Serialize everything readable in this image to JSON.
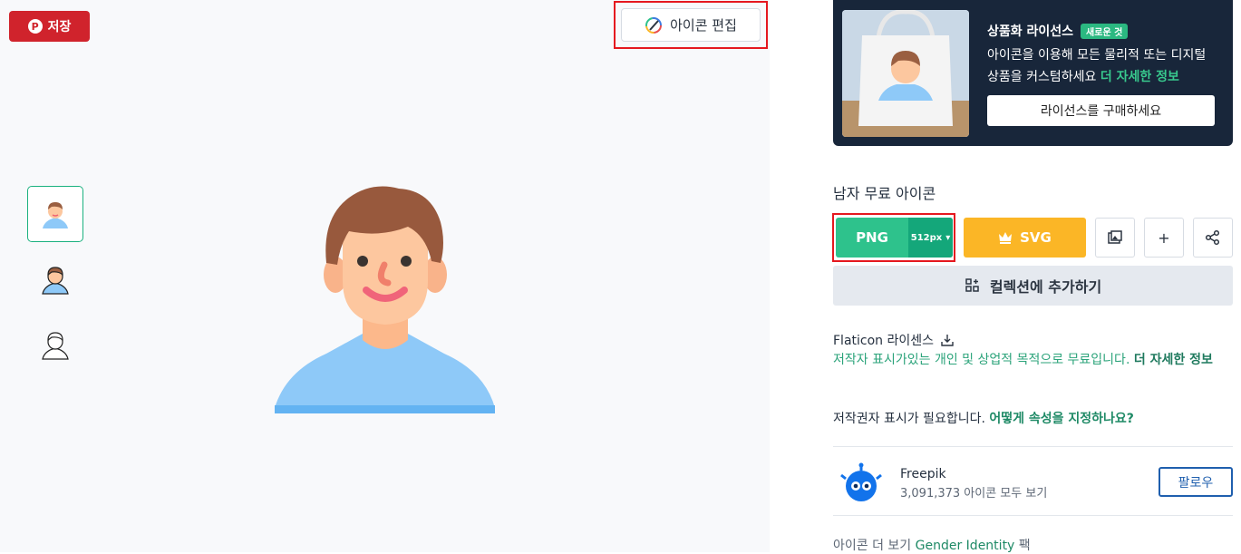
{
  "left": {
    "save_label": "저장",
    "edit_label": "아이콘 편집"
  },
  "promo": {
    "title": "상품화 라이선스",
    "badge": "새로운 것",
    "desc": "아이콘을 이용해 모든 물리적 또는 디지털 상품을 커스텀하세요",
    "desc_link": "더 자세한 정보",
    "button": "라이선스를 구매하세요"
  },
  "icon_title": "남자 무료 아이콘",
  "download": {
    "png_label": "PNG",
    "png_size": "512px",
    "svg_label": "SVG",
    "collection_label": "컬렉션에 추가하기"
  },
  "license": {
    "title": "Flaticon 라이센스",
    "desc": "저작자 표시가있는 개인 및 상업적 목적으로 무료입니다.",
    "more": "더 자세한 정보",
    "attr_text": "저작권자 표시가 필요합니다.",
    "attr_link": "어떻게 속성을 지정하나요?"
  },
  "author": {
    "name": "Freepik",
    "count": "3,091,373 아이콘 모두 보기",
    "follow": "팔로우"
  },
  "more": {
    "prefix": "아이콘 더 보기",
    "pack": "Gender Identity",
    "suffix": "팩"
  },
  "colors": {
    "accent_green": "#2ec28c",
    "svg_yellow": "#fbb626",
    "pinterest_red": "#d0232c",
    "promo_bg": "#18263a"
  }
}
